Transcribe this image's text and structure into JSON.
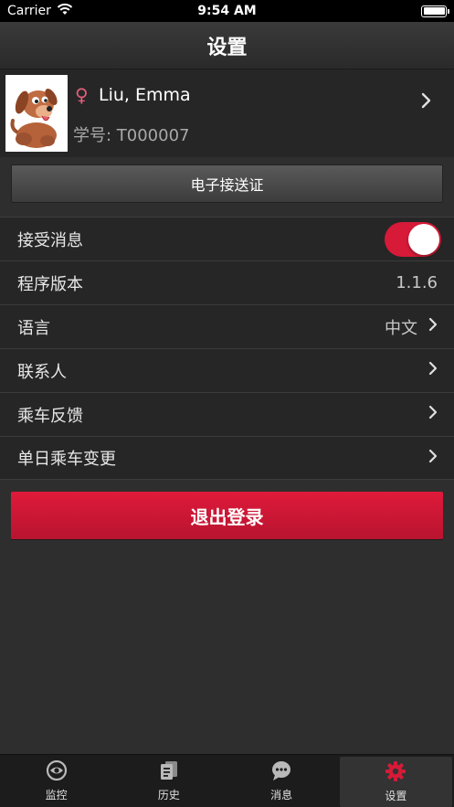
{
  "status_bar": {
    "carrier": "Carrier",
    "time": "9:54 AM"
  },
  "nav": {
    "title": "设置"
  },
  "profile": {
    "gender_symbol": "♀",
    "name": "Liu, Emma",
    "student_id": "学号: T000007"
  },
  "e_pass": {
    "label": "电子接送证"
  },
  "settings": {
    "receive_messages": {
      "label": "接受消息",
      "enabled": true
    },
    "app_version": {
      "label": "程序版本",
      "value": "1.1.6"
    },
    "language": {
      "label": "语言",
      "value": "中文"
    },
    "contacts": {
      "label": "联系人"
    },
    "ride_feedback": {
      "label": "乘车反馈"
    },
    "daily_ride_change": {
      "label": "单日乘车变更"
    }
  },
  "logout": {
    "label": "退出登录"
  },
  "tabs": [
    {
      "label": "监控",
      "icon": "monitor-icon",
      "active": false
    },
    {
      "label": "历史",
      "icon": "history-icon",
      "active": false
    },
    {
      "label": "消息",
      "icon": "message-icon",
      "active": false
    },
    {
      "label": "设置",
      "icon": "gear-icon",
      "active": true
    }
  ],
  "colors": {
    "accent_red": "#d61a38",
    "background": "#2e2e2e",
    "row_background": "#262626",
    "gender_pink": "#e0607a"
  }
}
